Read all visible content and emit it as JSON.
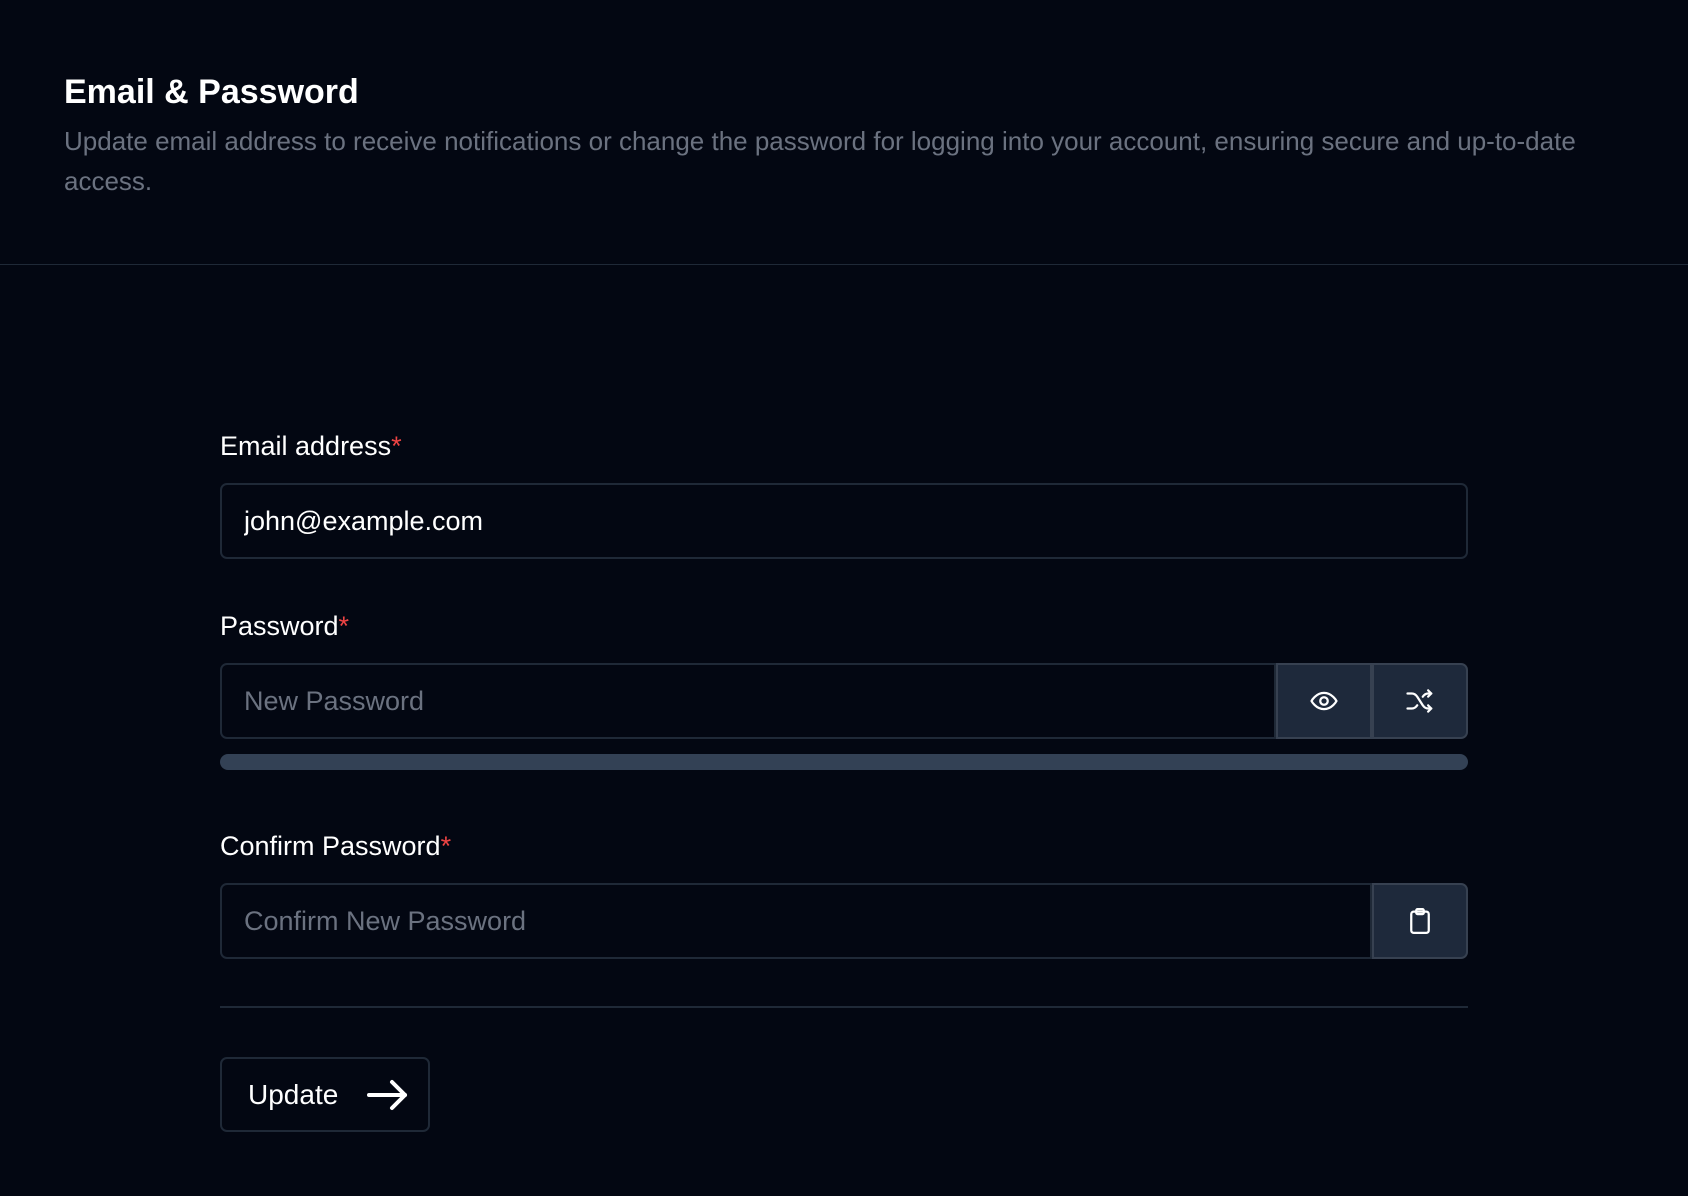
{
  "header": {
    "title": "Email & Password",
    "description": "Update email address to receive notifications or change the password for logging into your account, ensuring secure and up-to-date access."
  },
  "form": {
    "email": {
      "label": "Email address",
      "required_mark": "*",
      "value": "john@example.com"
    },
    "password": {
      "label": "Password",
      "required_mark": "*",
      "placeholder": "New Password",
      "strength_fraction": 0,
      "toggle_visibility_icon": "eye-icon",
      "generate_icon": "shuffle-icon"
    },
    "confirm_password": {
      "label": "Confirm Password",
      "required_mark": "*",
      "placeholder": "Confirm New Password",
      "paste_icon": "clipboard-icon"
    },
    "submit": {
      "label": "Update",
      "icon": "arrow-right-icon"
    }
  },
  "colors": {
    "background": "#030712",
    "border": "#1f2937",
    "muted_text": "#6b7280",
    "required": "#ef4444",
    "icon_button_bg": "#1e293b",
    "strength_track": "#334155"
  }
}
